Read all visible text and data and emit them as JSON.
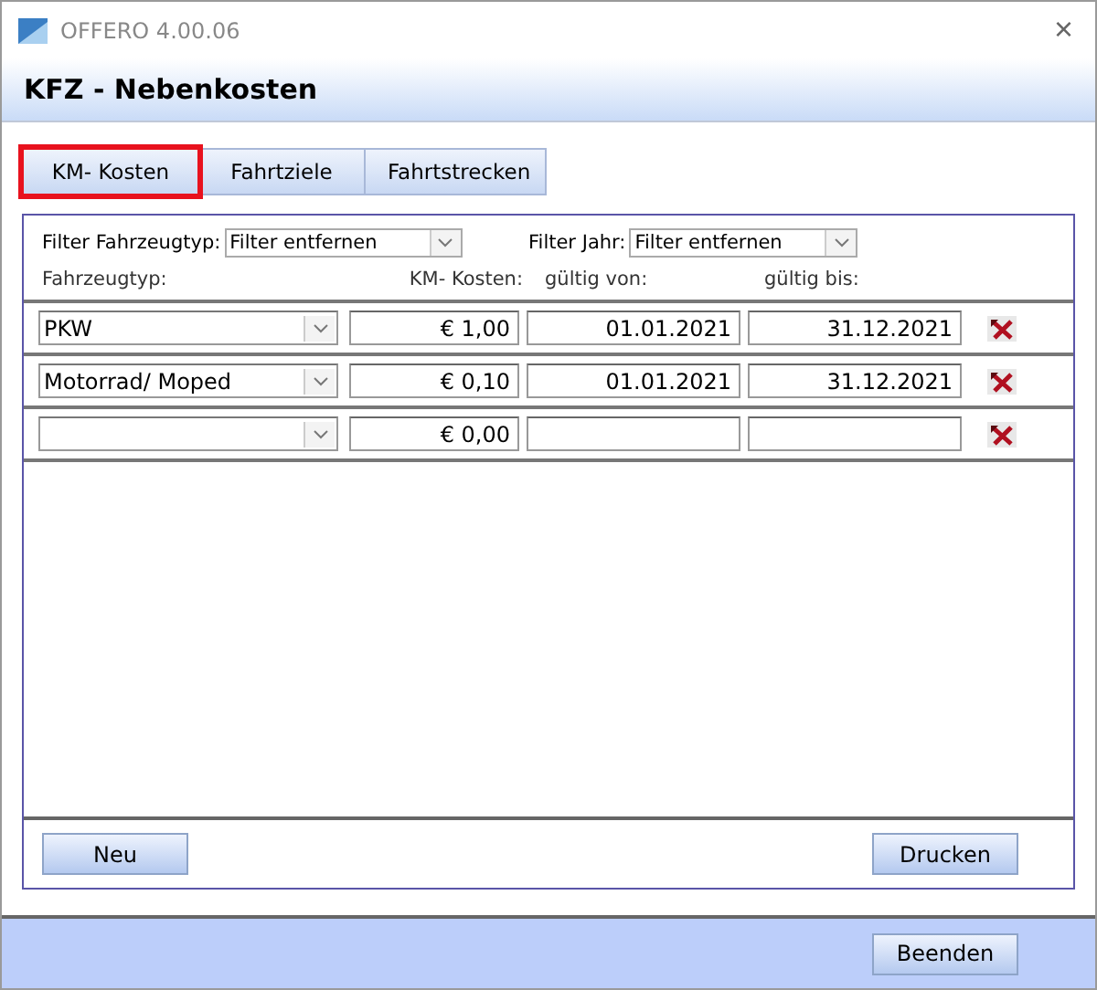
{
  "window": {
    "title": "OFFERO 4.00.06",
    "close": "×"
  },
  "header": {
    "title": "KFZ - Nebenkosten"
  },
  "tabs": [
    {
      "label": "KM- Kosten",
      "selected": true
    },
    {
      "label": "Fahrtziele",
      "selected": false
    },
    {
      "label": "Fahrtstrecken",
      "selected": false
    }
  ],
  "filters": [
    {
      "label": "Filter Fahrzeugtyp:",
      "value": "Filter entfernen"
    },
    {
      "label": "Filter Jahr:",
      "value": "Filter entfernen"
    }
  ],
  "columns": [
    "Fahrzeugtyp:",
    "KM- Kosten:",
    "gültig von:",
    "gültig bis:"
  ],
  "rows": [
    {
      "vehicle_type": "PKW",
      "km_cost": "€ 1,00",
      "valid_from": "01.01.2021",
      "valid_to": "31.12.2021"
    },
    {
      "vehicle_type": "Motorrad/ Moped",
      "km_cost": "€ 0,10",
      "valid_from": "01.01.2021",
      "valid_to": "31.12.2021"
    },
    {
      "vehicle_type": "",
      "km_cost": "€ 0,00",
      "valid_from": "",
      "valid_to": ""
    }
  ],
  "panel_buttons": [
    "Neu",
    "Drucken"
  ],
  "footer_buttons": [
    "Beenden"
  ]
}
